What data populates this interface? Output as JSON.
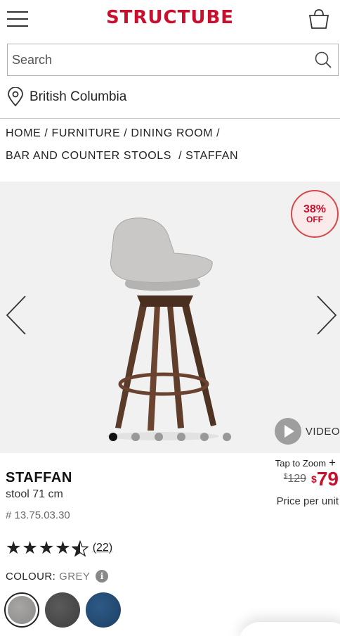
{
  "header": {
    "logo": "STRUCTUBE",
    "menu_icon": "hamburger-menu-icon",
    "cart_icon": "shopping-basket-icon",
    "brand_color": "#c8102e"
  },
  "search": {
    "placeholder": "Search",
    "value": "",
    "icon": "search-icon"
  },
  "location": {
    "label": "British Columbia",
    "icon": "location-pin-icon"
  },
  "breadcrumb": {
    "items": [
      "HOME",
      "FURNITURE",
      "DINING ROOM",
      "BAR AND COUNTER STOOLS",
      "STAFFAN"
    ],
    "separator": "/"
  },
  "gallery": {
    "badge_percent": "38%",
    "badge_off": "OFF",
    "image_count": 6,
    "active_index": 0,
    "video_label": "VIDEO",
    "prev_icon": "chevron-left-icon",
    "next_icon": "chevron-right-icon"
  },
  "product": {
    "zoom_label": "Tap to Zoom",
    "zoom_plus": "+",
    "name": "STAFFAN",
    "subtitle": "stool 71 cm",
    "sku": "# 13.75.03.30",
    "old_price_symbol": "$",
    "old_price": "129",
    "new_price_symbol": "$",
    "new_price": "79",
    "price_note": "Price per unit",
    "rating": 4.5,
    "review_count": "(22)"
  },
  "colour": {
    "label": "COLOUR:",
    "selected": "GREY",
    "info_icon": "info-icon",
    "info_glyph": "i",
    "swatches": [
      "grey",
      "charcoal",
      "blue"
    ]
  }
}
